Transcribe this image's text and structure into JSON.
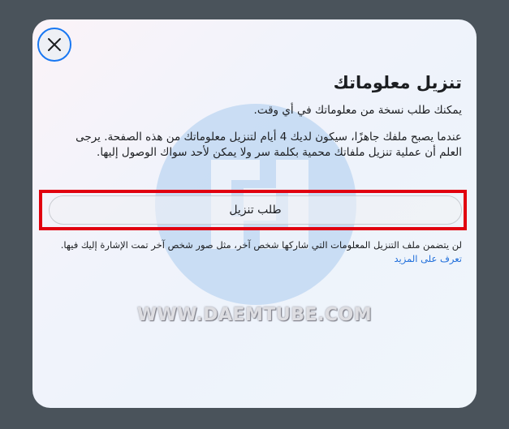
{
  "dialog": {
    "close_icon": "close-icon",
    "title": "تنزيل معلوماتك",
    "subtitle": "يمكنك طلب نسخة من معلوماتك في أي وقت.",
    "paragraph": "عندما يصبح ملفك جاهزًا، سيكون لديك 4 أيام لتنزيل معلوماتك من هذه الصفحة. يرجى العلم أن عملية تنزيل ملفاتك محمية بكلمة سر ولا يمكن لأحد سواك الوصول إليها.",
    "request_button_label": "طلب تنزيل",
    "note_text": "لن يتضمن ملف التنزيل المعلومات التي شاركها شخص آخر، مثل صور شخص آخر تمت الإشارة إليك فيها.",
    "learn_more_link": "تعرف على المزيد"
  },
  "watermark": {
    "text": "WWW.DAEMTUBE.COM",
    "logo_icon": "daemtube-logo-icon"
  },
  "colors": {
    "accent": "#1877f2",
    "highlight": "#e1000f",
    "link": "#216fdb",
    "backdrop": "#4a535b"
  }
}
